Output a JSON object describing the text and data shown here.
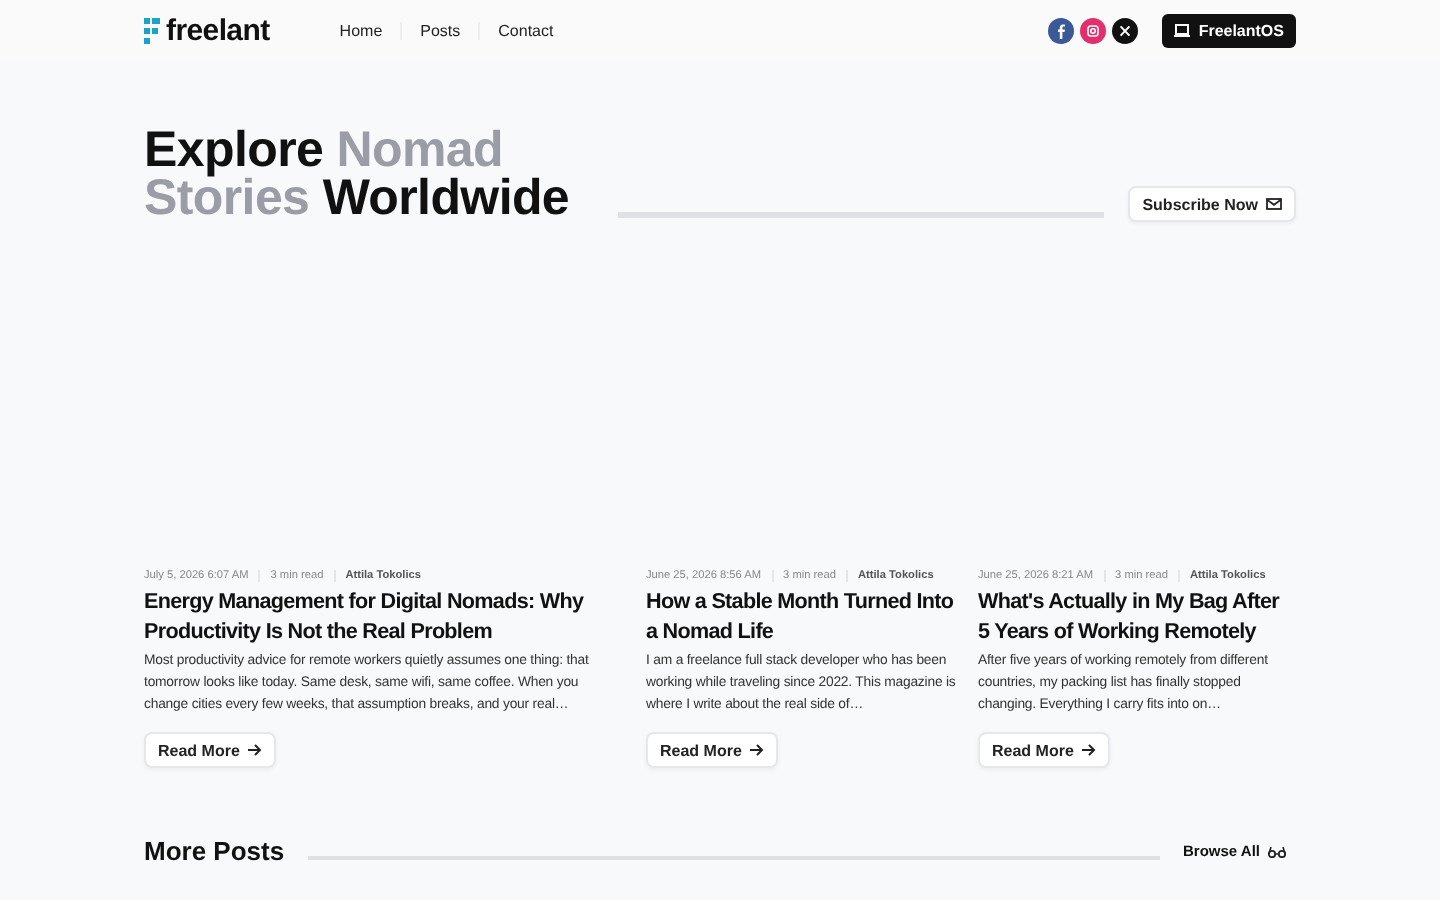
{
  "header": {
    "logo": "freelant",
    "nav": [
      {
        "label": "Home"
      },
      {
        "label": "Posts"
      },
      {
        "label": "Contact"
      }
    ],
    "socials": [
      {
        "kind": "facebook",
        "color": "#3b5998"
      },
      {
        "kind": "instagram",
        "color": "#e1306c"
      },
      {
        "kind": "x",
        "color": "#111111"
      }
    ],
    "cta": "FreelantOS"
  },
  "hero": {
    "title": [
      {
        "text": "Explore ",
        "muted": false
      },
      {
        "text": "Nomad ",
        "muted": true
      },
      {
        "text": "Stories ",
        "muted": true
      },
      {
        "text": "Worldwide",
        "muted": false
      }
    ],
    "subscribe": "Subscribe Now"
  },
  "posts": [
    {
      "date": "July 5, 2026 6:07 AM",
      "read_time": "3 min read",
      "author": "Attila Tokolics",
      "title": "Energy Management for Digital Nomads: Why Productivity Is Not the Real Problem",
      "excerpt": "Most productivity advice for remote workers quietly assumes one thing: that tomorrow looks like today. Same desk, same wifi, same coffee. When you change cities every few weeks, that assumption breaks, and your real…",
      "button": "Read More"
    },
    {
      "date": "June 25, 2026 8:56 AM",
      "read_time": "3 min read",
      "author": "Attila Tokolics",
      "title": "How a Stable Month Turned Into a Nomad Life",
      "excerpt": "I am a freelance full stack developer who has been working while traveling since 2022. This magazine is where I write about the real side of…",
      "button": "Read More"
    },
    {
      "date": "June 25, 2026 8:21 AM",
      "read_time": "3 min read",
      "author": "Attila Tokolics",
      "title": "What's Actually in My Bag After 5 Years of Working Remotely",
      "excerpt": "After five years of working remotely from different countries, my packing list has finally stopped changing. Everything I carry fits into on…",
      "button": "Read More"
    }
  ],
  "more": {
    "title": "More Posts",
    "browse": "Browse All"
  }
}
